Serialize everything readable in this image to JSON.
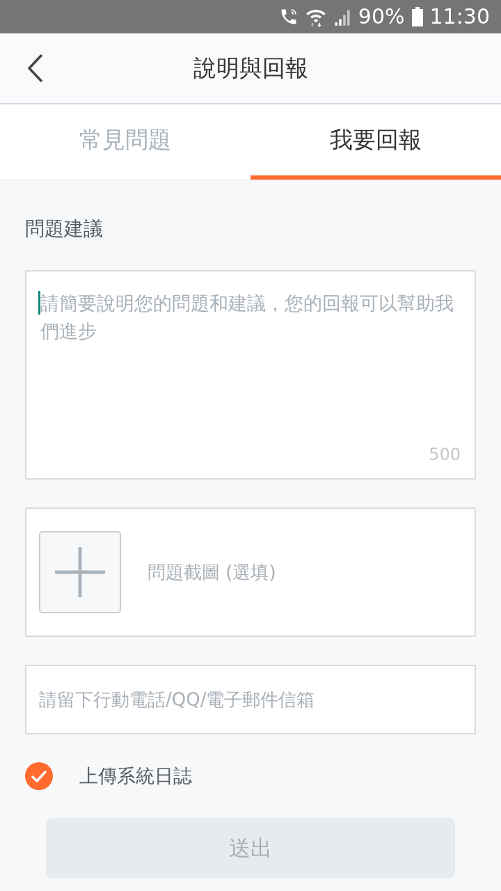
{
  "status_bar": {
    "battery": "90%",
    "time": "11:30"
  },
  "header": {
    "title": "說明與回報"
  },
  "tabs": [
    {
      "label": "常見問題",
      "selected": false
    },
    {
      "label": "我要回報",
      "selected": true
    }
  ],
  "form": {
    "section_label": "問題建議",
    "description": {
      "placeholder": "請簡要說明您的問題和建議，您的回報可以幫助我們進步",
      "counter": "500",
      "focused": true
    },
    "screenshot": {
      "label": "問題截圖 (選填)"
    },
    "contact": {
      "placeholder": "請留下行動電話/QQ/電子郵件信箱"
    },
    "upload_log": {
      "label": "上傳系統日誌",
      "checked": true
    },
    "submit": {
      "label": "送出",
      "disabled": true
    }
  }
}
